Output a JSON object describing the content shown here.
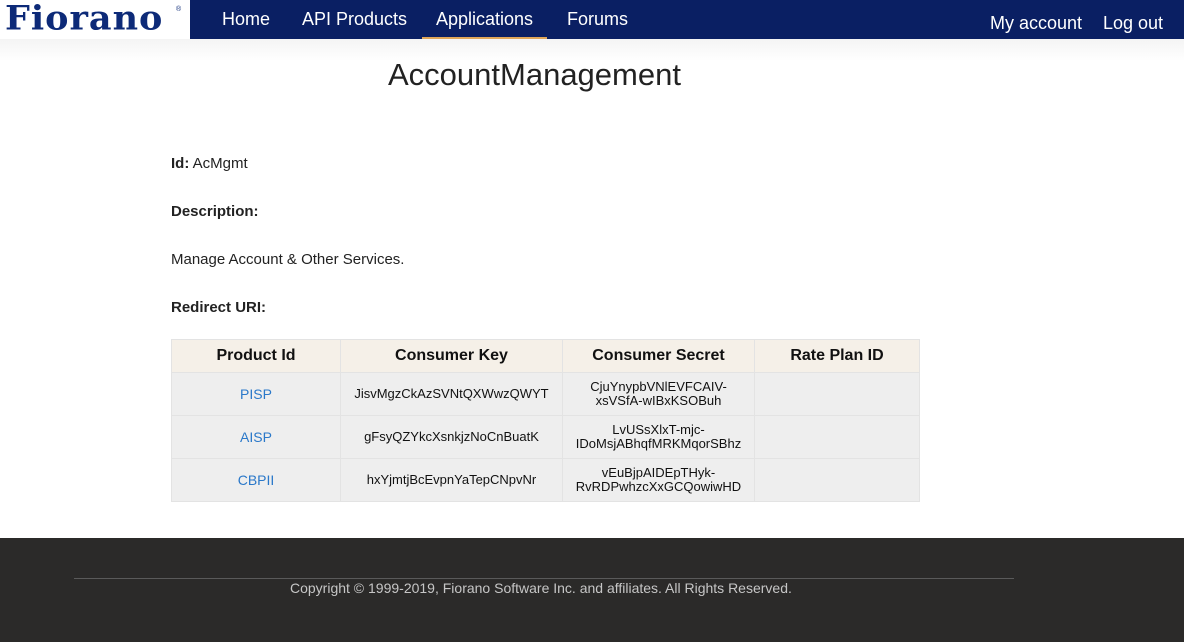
{
  "brand": {
    "logo_text": "Fiorano",
    "logo_mark": "®"
  },
  "nav": {
    "items": [
      {
        "label": "Home"
      },
      {
        "label": "API Products"
      },
      {
        "label": "Applications",
        "active": true
      },
      {
        "label": "Forums"
      }
    ],
    "right": [
      {
        "label": "My account"
      },
      {
        "label": "Log out"
      }
    ]
  },
  "page": {
    "title": "AccountManagement",
    "id_label": "Id:",
    "id_value": "AcMgmt",
    "description_label": "Description:",
    "description_value": "Manage Account & Other Services.",
    "redirect_label": "Redirect URI:"
  },
  "table": {
    "headers": [
      "Product Id",
      "Consumer Key",
      "Consumer Secret",
      "Rate Plan ID"
    ],
    "rows": [
      {
        "product_id": "PISP",
        "consumer_key": "JisvMgzCkAzSVNtQXWwzQWYT",
        "secret_line1": "CjuYnypbVNlEVFCAIV-",
        "secret_line2": "xsVSfA-wIBxKSOBuh",
        "rate_plan": ""
      },
      {
        "product_id": "AISP",
        "consumer_key": "gFsyQZYkcXsnkjzNoCnBuatK",
        "secret_line1": "LvUSsXlxT-mjc-",
        "secret_line2": "IDoMsjABhqfMRKMqorSBhz",
        "rate_plan": ""
      },
      {
        "product_id": "CBPII",
        "consumer_key": "hxYjmtjBcEvpnYaTepCNpvNr",
        "secret_line1": "vEuBjpAIDEpTHyk-",
        "secret_line2": "RvRDPwhzcXxGCQowiwHD",
        "rate_plan": ""
      }
    ]
  },
  "footer": {
    "copyright": "Copyright © 1999-2019, Fiorano Software Inc. and affiliates. All Rights Reserved."
  },
  "colors": {
    "nav_bg": "#0a1f63",
    "logo": "#0d2a78",
    "active_underline": "#e0a75a",
    "link": "#2a78c9",
    "footer_bg": "#2b2a29"
  }
}
